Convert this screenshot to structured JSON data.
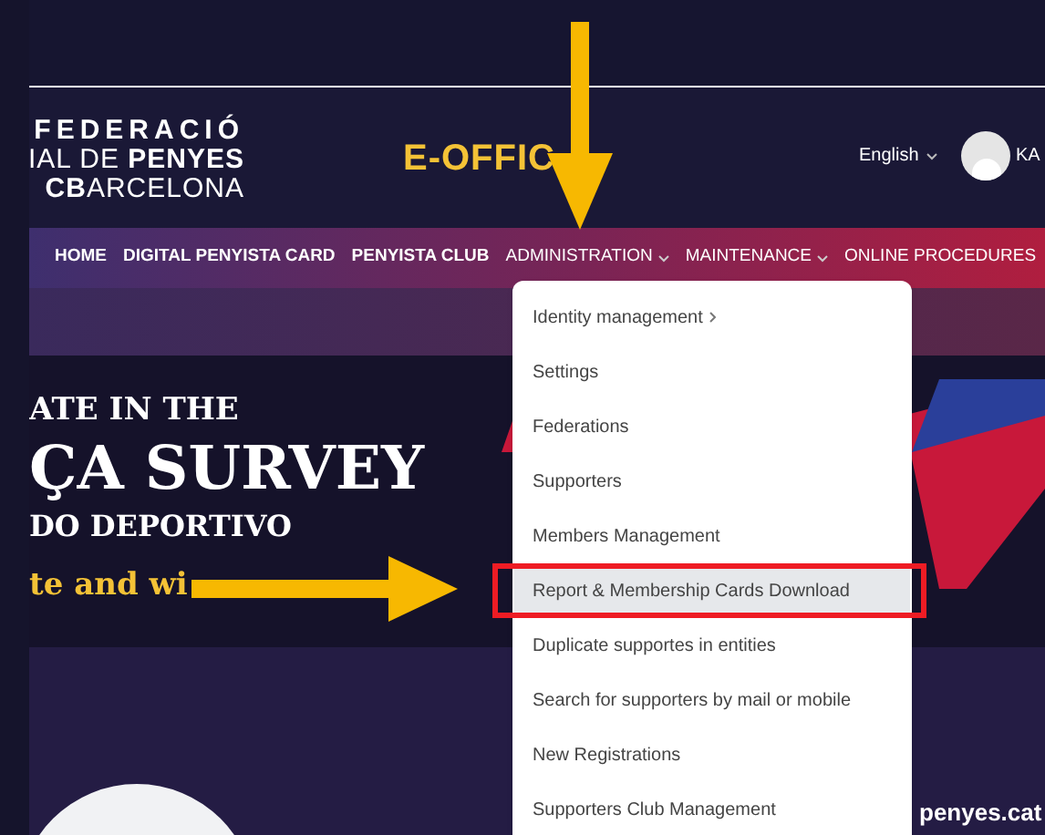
{
  "logo": {
    "lines": [
      "FEDERACIÓ",
      "IAL DE **PENYES**",
      "**CB**ARCELONA"
    ]
  },
  "header": {
    "title": "E-OFFIC",
    "language": "English",
    "user": "KA"
  },
  "nav": [
    {
      "label": "HOME",
      "dropdown": false,
      "bold": true
    },
    {
      "label": "DIGITAL PENYISTA CARD",
      "dropdown": false,
      "bold": true
    },
    {
      "label": "PENYISTA CLUB",
      "dropdown": false,
      "bold": true
    },
    {
      "label": "ADMINISTRATION",
      "dropdown": true,
      "bold": false
    },
    {
      "label": "MAINTENANCE",
      "dropdown": true,
      "bold": false
    },
    {
      "label": "ONLINE PROCEDURES",
      "dropdown": false,
      "bold": false
    }
  ],
  "banner": {
    "lines": [
      "ATE IN THE",
      "ÇA SURVEY",
      "DO DEPORTIVO",
      "te and wi"
    ],
    "site": "penyes.cat"
  },
  "menu": [
    {
      "label": "Identity management",
      "submenu": true,
      "selected": false
    },
    {
      "label": "Settings",
      "submenu": false,
      "selected": false
    },
    {
      "label": "Federations",
      "submenu": false,
      "selected": false
    },
    {
      "label": "Supporters",
      "submenu": false,
      "selected": false
    },
    {
      "label": "Members Management",
      "submenu": false,
      "selected": false
    },
    {
      "label": "Report & Membership Cards Download",
      "submenu": false,
      "selected": true
    },
    {
      "label": "Duplicate supportes in entities",
      "submenu": false,
      "selected": false
    },
    {
      "label": "Search for supporters by mail or mobile",
      "submenu": false,
      "selected": false
    },
    {
      "label": "New Registrations",
      "submenu": false,
      "selected": false
    },
    {
      "label": "Supporters Club Management",
      "submenu": false,
      "selected": false
    }
  ],
  "annotations": [
    {
      "kind": "arrow-down"
    },
    {
      "kind": "arrow-right"
    },
    {
      "kind": "highlight-box"
    }
  ]
}
